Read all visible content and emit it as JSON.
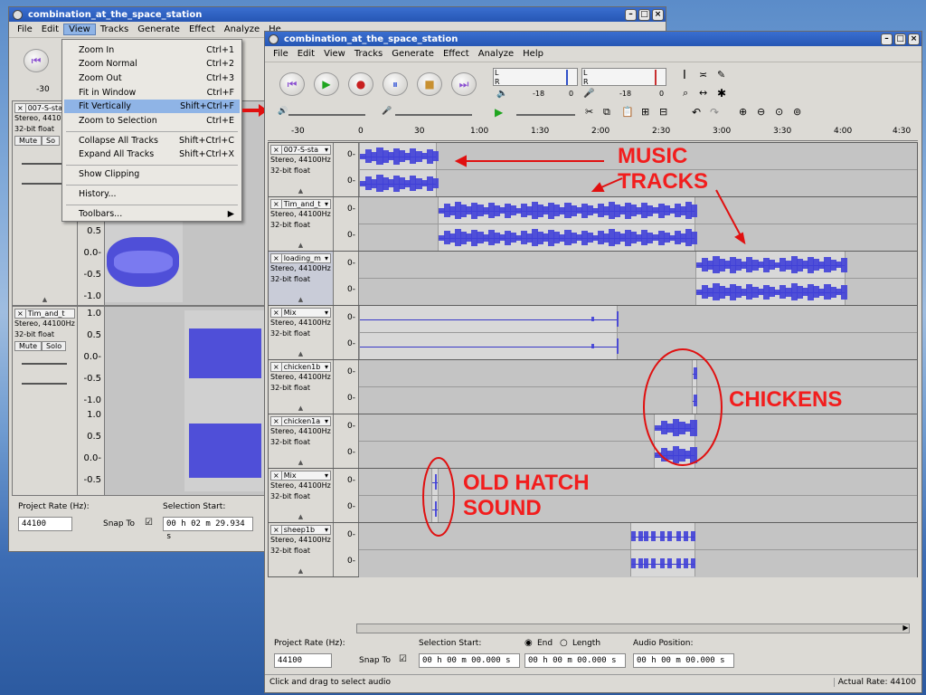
{
  "back_window": {
    "title": "combination_at_the_space_station",
    "menu": [
      "File",
      "Edit",
      "View",
      "Tracks",
      "Generate",
      "Effect",
      "Analyze",
      "He"
    ],
    "ruler_tick": "-30",
    "track1": {
      "name": "007-S-sta",
      "info1": "Stereo, 4410",
      "info2": "32-bit float",
      "mute": "Mute",
      "solo": "So"
    },
    "track2": {
      "name": "Tim_and_t",
      "info1": "Stereo, 44100Hz",
      "info2": "32-bit float",
      "mute": "Mute",
      "solo": "Solo"
    },
    "scale1": [
      "0.5",
      "0.0-",
      "-0.5",
      "-1.0"
    ],
    "scale2": [
      "1.0",
      "0.5",
      "0.0-",
      "-0.5",
      "-1.0",
      "1.0",
      "0.5",
      "0.0-",
      "-0.5"
    ],
    "project_rate_label": "Project Rate (Hz):",
    "project_rate": "44100",
    "snap_label": "Snap To",
    "selection_start_label": "Selection Start:",
    "selection_start": "00 h 02 m 29.934 s"
  },
  "view_menu": {
    "items": [
      {
        "label": "Zoom In",
        "key": "Ctrl+1"
      },
      {
        "label": "Zoom Normal",
        "key": "Ctrl+2"
      },
      {
        "label": "Zoom Out",
        "key": "Ctrl+3"
      },
      {
        "label": "Fit in Window",
        "key": "Ctrl+F"
      },
      {
        "label": "Fit Vertically",
        "key": "Shift+Ctrl+F"
      },
      {
        "label": "Zoom to Selection",
        "key": "Ctrl+E"
      },
      {
        "label": "Collapse All Tracks",
        "key": "Shift+Ctrl+C"
      },
      {
        "label": "Expand All Tracks",
        "key": "Shift+Ctrl+X"
      },
      {
        "label": "Show Clipping",
        "key": ""
      },
      {
        "label": "History...",
        "key": ""
      },
      {
        "label": "Toolbars...",
        "key": "▶"
      }
    ]
  },
  "main_window": {
    "title": "combination_at_the_space_station",
    "menu": [
      "File",
      "Edit",
      "View",
      "Tracks",
      "Generate",
      "Effect",
      "Analyze",
      "Help"
    ],
    "meter_labels": {
      "l": "L",
      "r": "R",
      "v1": "-18",
      "v2": "0",
      "v3": "-18",
      "v4": "0"
    },
    "ruler_ticks": [
      "-30",
      "0",
      "30",
      "1:00",
      "1:30",
      "2:00",
      "2:30",
      "3:00",
      "3:30",
      "4:00",
      "4:30"
    ],
    "tracks": [
      {
        "name": "007-S-sta",
        "info1": "Stereo, 44100Hz",
        "info2": "32-bit float"
      },
      {
        "name": "Tim_and_t",
        "info1": "Stereo, 44100Hz",
        "info2": "32-bit float"
      },
      {
        "name": "loading_m",
        "info1": "Stereo, 44100Hz",
        "info2": "32-bit float"
      },
      {
        "name": "Mix",
        "info1": "Stereo, 44100Hz",
        "info2": "32-bit float"
      },
      {
        "name": "chicken1b",
        "info1": "Stereo, 44100Hz",
        "info2": "32-bit float"
      },
      {
        "name": "chicken1a",
        "info1": "Stereo, 44100Hz",
        "info2": "32-bit float"
      },
      {
        "name": "Mix",
        "info1": "Stereo, 44100Hz",
        "info2": "32-bit float"
      },
      {
        "name": "sheep1b",
        "info1": "Stereo, 44100Hz",
        "info2": "32-bit float"
      }
    ],
    "zero_label": "0-",
    "project_rate_label": "Project Rate (Hz):",
    "project_rate": "44100",
    "snap_label": "Snap To",
    "selection_start_label": "Selection Start:",
    "end_label": "End",
    "length_label": "Length",
    "audio_position_label": "Audio Position:",
    "selection_start": "00 h 00 m 00.000 s",
    "end": "00 h 00 m 00.000 s",
    "audio_position": "00 h 00 m 00.000 s",
    "status_left": "Click and drag to select audio",
    "status_right": "Actual Rate: 44100"
  },
  "annotations": {
    "music": "MUSIC",
    "tracks": "TRACKS",
    "chickens": "CHICKENS",
    "old_hatch": "OLD HATCH",
    "sound": "SOUND"
  },
  "colors": {
    "annotation": "#f21d1d",
    "waveform": "#4040d8",
    "titlebar": "#2656b4"
  }
}
